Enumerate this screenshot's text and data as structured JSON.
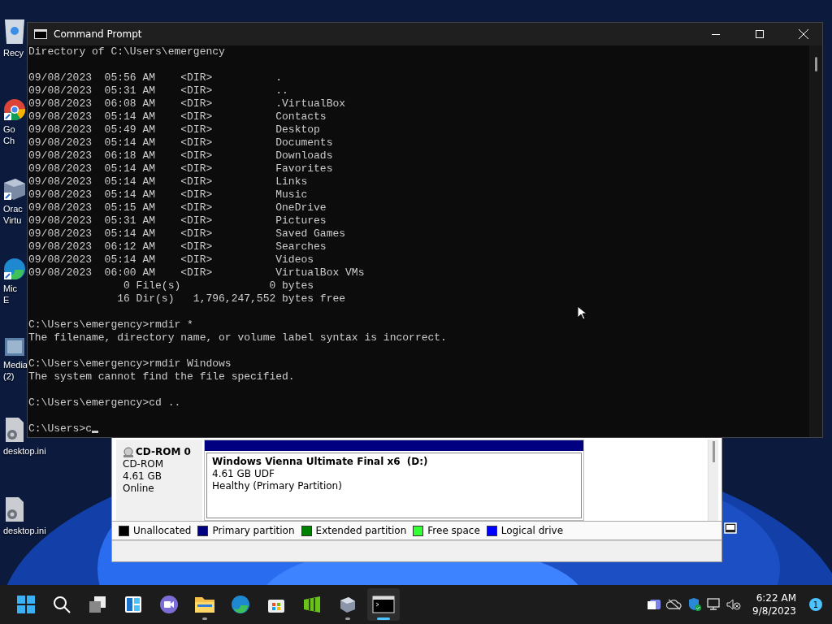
{
  "desktop_icons": [
    {
      "kind": "bin",
      "lines": [
        "Recy"
      ]
    },
    {
      "kind": "chrome",
      "lines": [
        "Go",
        "Ch"
      ]
    },
    {
      "kind": "vbox",
      "lines": [
        "Orac",
        "Virtu"
      ]
    },
    {
      "kind": "edge",
      "lines": [
        "Mic",
        "E"
      ]
    },
    {
      "kind": "media",
      "lines": [
        "Media",
        "(2)"
      ]
    },
    {
      "kind": "ini",
      "lines": [
        "desktop.ini"
      ]
    },
    {
      "kind": "ini",
      "lines": [
        "desktop.ini"
      ]
    }
  ],
  "console": {
    "title": "Command Prompt",
    "blocks": [
      [
        "Directory of C:\\Users\\emergency"
      ],
      [
        "09/08/2023  05:56 AM    <DIR>          .",
        "09/08/2023  05:31 AM    <DIR>          ..",
        "09/08/2023  06:08 AM    <DIR>          .VirtualBox",
        "09/08/2023  05:14 AM    <DIR>          Contacts",
        "09/08/2023  05:49 AM    <DIR>          Desktop",
        "09/08/2023  05:14 AM    <DIR>          Documents",
        "09/08/2023  06:18 AM    <DIR>          Downloads",
        "09/08/2023  05:14 AM    <DIR>          Favorites",
        "09/08/2023  05:14 AM    <DIR>          Links",
        "09/08/2023  05:14 AM    <DIR>          Music",
        "09/08/2023  05:15 AM    <DIR>          OneDrive",
        "09/08/2023  05:31 AM    <DIR>          Pictures",
        "09/08/2023  05:14 AM    <DIR>          Saved Games",
        "09/08/2023  06:12 AM    <DIR>          Searches",
        "09/08/2023  05:14 AM    <DIR>          Videos",
        "09/08/2023  06:00 AM    <DIR>          VirtualBox VMs",
        "               0 File(s)              0 bytes",
        "              16 Dir(s)   1,796,247,552 bytes free"
      ],
      [
        "C:\\Users\\emergency>rmdir *",
        "The filename, directory name, or volume label syntax is incorrect."
      ],
      [
        "C:\\Users\\emergency>rmdir Windows",
        "The system cannot find the file specified."
      ],
      [
        "C:\\Users\\emergency>cd .."
      ],
      [
        "C:\\Users>c"
      ]
    ]
  },
  "disk_window": {
    "disk": {
      "name": "CD-ROM 0",
      "type": "CD-ROM",
      "size": "4.61 GB",
      "status": "Online"
    },
    "partition": {
      "name": "Windows Vienna Ultimate Final x6  (D:)",
      "size": "4.61 GB UDF",
      "status": "Healthy (Primary Partition)",
      "color": "#000080"
    },
    "legend": [
      {
        "label": "Unallocated",
        "color": "#000000"
      },
      {
        "label": "Primary partition",
        "color": "#000080"
      },
      {
        "label": "Extended partition",
        "color": "#008000"
      },
      {
        "label": "Free space",
        "color": "#33ff33"
      },
      {
        "label": "Logical drive",
        "color": "#0000ff"
      }
    ]
  },
  "taskbar": {
    "apps": [
      {
        "kind": "start",
        "selected": false,
        "running": false
      },
      {
        "kind": "search",
        "selected": false,
        "running": false
      },
      {
        "kind": "taskview",
        "selected": false,
        "running": false
      },
      {
        "kind": "widgets",
        "selected": false,
        "running": false
      },
      {
        "kind": "chat",
        "selected": false,
        "running": false
      },
      {
        "kind": "explorer",
        "selected": false,
        "running": true
      },
      {
        "kind": "edge",
        "selected": false,
        "running": false
      },
      {
        "kind": "store",
        "selected": false,
        "running": false
      },
      {
        "kind": "green",
        "selected": false,
        "running": false
      },
      {
        "kind": "vbox",
        "selected": false,
        "running": true
      },
      {
        "kind": "terminal",
        "selected": true,
        "running": true
      }
    ],
    "time": "6:22 AM",
    "date": "9/8/2023",
    "badge": "1"
  }
}
